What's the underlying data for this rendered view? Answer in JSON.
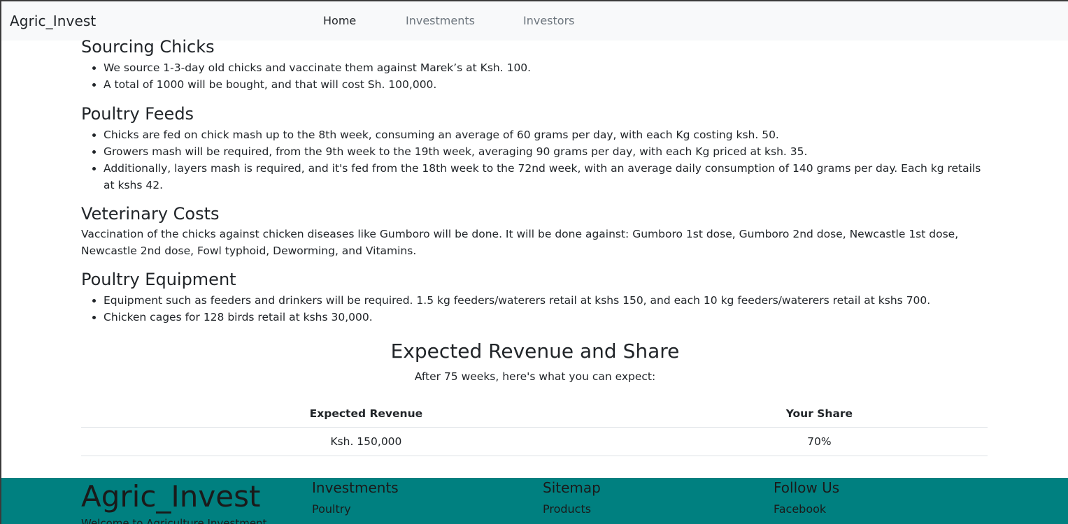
{
  "navbar": {
    "brand": "Agric_Invest",
    "links": [
      {
        "label": "Home",
        "active": true
      },
      {
        "label": "Investments",
        "active": false
      },
      {
        "label": "Investors",
        "active": false
      }
    ]
  },
  "sections": {
    "chicks": {
      "title": "Sourcing Chicks",
      "items": [
        "We source 1-3-day old chicks and vaccinate them against Marek’s at Ksh. 100.",
        "A total of 1000 will be bought, and that will cost Sh. 100,000."
      ]
    },
    "feeds": {
      "title": "Poultry Feeds",
      "items": [
        "Chicks are fed on chick mash up to the 8th week, consuming an average of 60 grams per day, with each Kg costing ksh. 50.",
        "Growers mash will be required, from the 9th week to the 19th week, averaging 90 grams per day, with each Kg priced at ksh. 35.",
        "Additionally, layers mash is required, and it's fed from the 18th week to the 72nd week, with an average daily consumption of 140 grams per day. Each kg retails at kshs 42."
      ]
    },
    "vet": {
      "title": "Veterinary Costs",
      "text": "Vaccination of the chicks against chicken diseases like Gumboro will be done. It will be done against: Gumboro 1st dose, Gumboro 2nd dose, Newcastle 1st dose, Newcastle 2nd dose, Fowl typhoid, Deworming, and Vitamins."
    },
    "equipment": {
      "title": "Poultry Equipment",
      "items": [
        "Equipment such as feeders and drinkers will be required. 1.5 kg feeders/waterers retail at kshs 150, and each 10 kg feeders/waterers retail at kshs 700.",
        "Chicken cages for 128 birds retail at kshs 30,000."
      ]
    }
  },
  "revenue": {
    "title": "Expected Revenue and Share",
    "subtitle": "After 75 weeks, here's what you can expect:",
    "headers": [
      "Expected Revenue",
      "Your Share"
    ],
    "row": [
      "Ksh. 150,000",
      "70%"
    ]
  },
  "footer": {
    "brand": "Agric_Invest",
    "welcome": "Welcome to Agriculture Investment",
    "columns": [
      {
        "title": "Investments",
        "link": "Poultry"
      },
      {
        "title": "Sitemap",
        "link": "Products"
      },
      {
        "title": "Follow Us",
        "link": "Facebook"
      }
    ],
    "bg_color": "#008080"
  }
}
